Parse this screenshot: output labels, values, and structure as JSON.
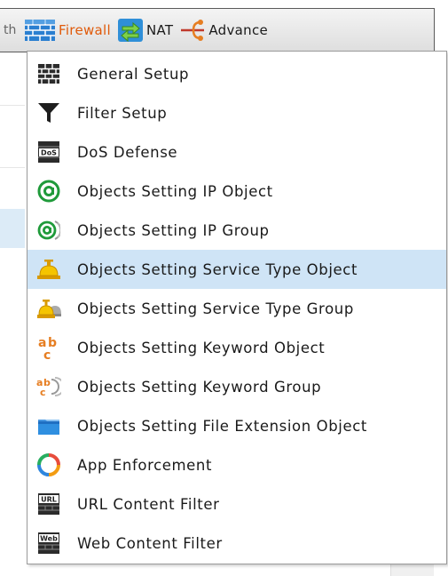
{
  "toolbar": {
    "prev_fragment": "th",
    "items": [
      {
        "label": "Firewall",
        "icon": "firewall-brick-icon",
        "active": true
      },
      {
        "label": "NAT",
        "icon": "nat-arrows-icon",
        "active": false
      },
      {
        "label": "Advance",
        "icon": "advance-branch-icon",
        "active": false
      }
    ]
  },
  "menu": {
    "items": [
      {
        "label": "General Setup",
        "icon": "brick-wall-icon"
      },
      {
        "label": "Filter Setup",
        "icon": "funnel-icon"
      },
      {
        "label": "DoS Defense",
        "icon": "dos-shield-icon",
        "icon_text": "DoS"
      },
      {
        "label": "Objects Setting IP Object",
        "icon": "at-sign-icon"
      },
      {
        "label": "Objects Setting IP Group",
        "icon": "at-sign-group-icon"
      },
      {
        "label": "Objects Setting Service Type Object",
        "icon": "service-bell-icon",
        "selected": true
      },
      {
        "label": "Objects Setting Service Type Group",
        "icon": "service-bell-group-icon"
      },
      {
        "label": "Objects Setting Keyword Object",
        "icon": "abc-keyword-icon"
      },
      {
        "label": "Objects Setting Keyword Group",
        "icon": "abc-keyword-group-icon"
      },
      {
        "label": "Objects Setting File Extension Object",
        "icon": "folder-icon"
      },
      {
        "label": "App Enforcement",
        "icon": "app-ring-icon"
      },
      {
        "label": "URL Content Filter",
        "icon": "url-shield-icon",
        "icon_text": "URL"
      },
      {
        "label": "Web Content Filter",
        "icon": "web-shield-icon",
        "icon_text": "Web"
      }
    ]
  },
  "colors": {
    "active_tab": "#e05a0a",
    "selected_row": "#cfe4f6",
    "menu_border": "#9a9a9a"
  }
}
